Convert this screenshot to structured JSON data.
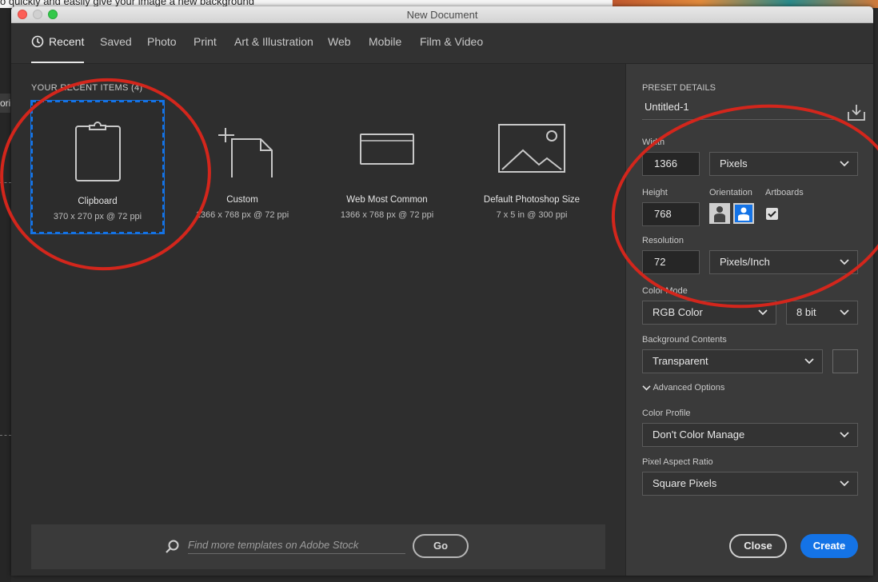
{
  "background": {
    "snippet_text": "o quickly and easily give your image a new background",
    "left_tab_text": "ori"
  },
  "window": {
    "title": "New Document"
  },
  "tabs": [
    {
      "label": "Recent",
      "active": true
    },
    {
      "label": "Saved"
    },
    {
      "label": "Photo"
    },
    {
      "label": "Print"
    },
    {
      "label": "Art & Illustration"
    },
    {
      "label": "Web"
    },
    {
      "label": "Mobile"
    },
    {
      "label": "Film & Video"
    }
  ],
  "recent": {
    "heading": "YOUR RECENT ITEMS",
    "count": "(4)",
    "items": [
      {
        "name": "Clipboard",
        "details": "370 x 270 px @ 72 ppi",
        "icon": "clipboard-icon",
        "selected": true
      },
      {
        "name": "Custom",
        "details": "1366 x 768 px @ 72 ppi",
        "icon": "custom-document-icon"
      },
      {
        "name": "Web Most Common",
        "details": "1366 x 768 px @ 72 ppi",
        "icon": "browser-window-icon"
      },
      {
        "name": "Default Photoshop Size",
        "details": "7 x 5 in @ 300 ppi",
        "icon": "landscape-image-icon"
      }
    ]
  },
  "search": {
    "placeholder": "Find more templates on Adobe Stock",
    "go_label": "Go"
  },
  "preset": {
    "heading": "PRESET DETAILS",
    "name": "Untitled-1",
    "width_label": "Width",
    "width_value": "1366",
    "width_unit": "Pixels",
    "height_label": "Height",
    "height_value": "768",
    "orientation_label": "Orientation",
    "orientation": "landscape",
    "artboards_label": "Artboards",
    "artboards_checked": true,
    "resolution_label": "Resolution",
    "resolution_value": "72",
    "resolution_unit": "Pixels/Inch",
    "color_mode_label": "Color Mode",
    "color_mode": "RGB Color",
    "bit_depth": "8 bit",
    "bg_contents_label": "Background Contents",
    "bg_contents": "Transparent",
    "advanced_label": "Advanced Options",
    "color_profile_label": "Color Profile",
    "color_profile": "Don't Color Manage",
    "pixel_aspect_label": "Pixel Aspect Ratio",
    "pixel_aspect": "Square Pixels"
  },
  "buttons": {
    "close": "Close",
    "create": "Create"
  },
  "colors": {
    "accent": "#1473e6",
    "annotation": "#d3261c"
  }
}
